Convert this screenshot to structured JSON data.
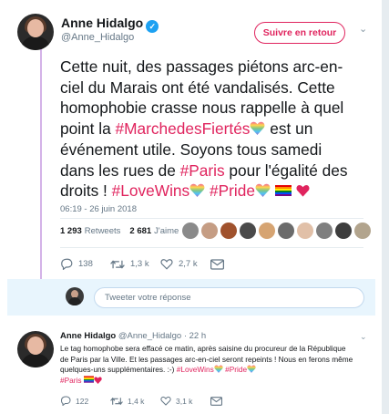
{
  "colors": {
    "accent": "#e0245e",
    "link": "#1da1f2",
    "muted": "#657786",
    "thread_line": "#d4b3e8"
  },
  "author": {
    "name": "Anne Hidalgo",
    "handle": "@Anne_Hidalgo",
    "verified_icon": "verified-badge-icon"
  },
  "follow_button": {
    "label": "Suivre en retour"
  },
  "tweet": {
    "t1": "Cette nuit, des passages piétons arc-en-ciel du Marais ont été vandalisés. Cette homophobie crasse nous rappelle à quel point la ",
    "tag1": "#MarchedesFiertés",
    "t2": " est un événement utile. Soyons tous samedi dans les rues de ",
    "tag2": "#Paris",
    "t3": " pour l'égalité des droits ! ",
    "tag3": "#LoveWins",
    "t4": " ",
    "tag4": "#Pride",
    "timestamp": "06:19 - 26 juin 2018"
  },
  "stats": {
    "retweets_count": "1 293",
    "retweets_label": "Retweets",
    "likes_count": "2 681",
    "likes_label": "J'aime"
  },
  "likers": [
    "#8a8a8a",
    "#c59d84",
    "#a0522d",
    "#4a4a4a",
    "#d6a472",
    "#6b6b6b",
    "#e1c0a8",
    "#7f7f7f",
    "#3d3d3d",
    "#b2a48d"
  ],
  "actions": {
    "reply": "138",
    "retweet": "1,3 k",
    "like": "2,7 k"
  },
  "reply_box": {
    "placeholder": "Tweeter votre réponse"
  },
  "reply": {
    "name": "Anne Hidalgo",
    "handle_time": "@Anne_Hidalgo · 22 h",
    "t1": "Le tag homophobe sera effacé ce matin, après saisine du procureur de la République de Paris par la Ville. Et les passages arc-en-ciel seront repeints ! Nous en ferons même quelques-uns supplémentaires. :-) ",
    "tag1": "#LoveWins",
    "tag2": "#Pride",
    "tag3": "#Paris",
    "actions": {
      "reply": "122",
      "retweet": "1,4 k",
      "like": "3,1 k"
    }
  }
}
